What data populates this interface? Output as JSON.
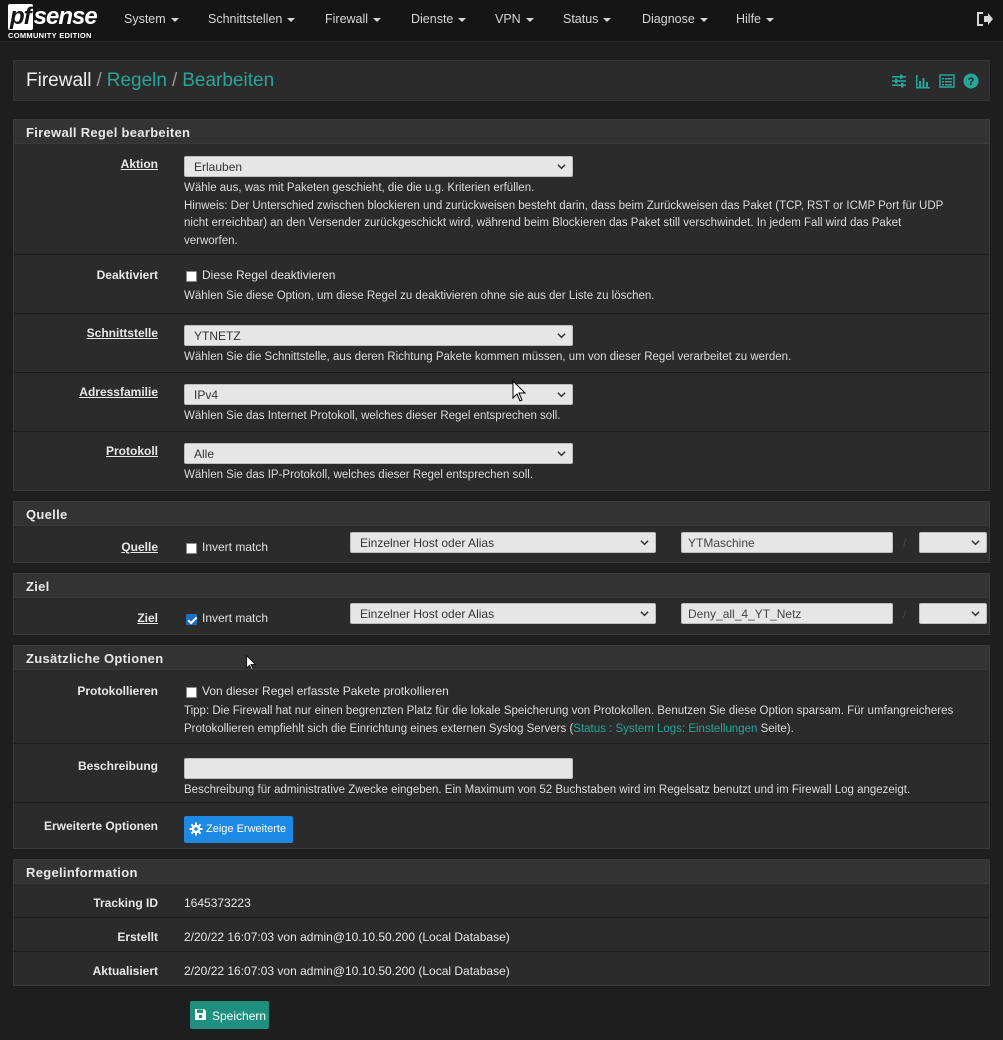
{
  "nav": {
    "logo_main": "sense",
    "logo_pf": "pf",
    "logo_sub": "COMMUNITY EDITION",
    "items": [
      "System",
      "Schnittstellen",
      "Firewall",
      "Dienste",
      "VPN",
      "Status",
      "Diagnose",
      "Hilfe"
    ]
  },
  "breadcrumb": {
    "root": "Firewall",
    "sep1": "/",
    "link1": "Regeln",
    "sep2": "/",
    "link2": "Bearbeiten"
  },
  "icons": {
    "bc": [
      "sliders-icon",
      "bar-chart-icon",
      "list-icon",
      "help-icon"
    ],
    "logout": "logout-icon"
  },
  "edit": {
    "heading": "Firewall Regel bearbeiten",
    "action": {
      "label": "Aktion",
      "value": "Erlauben",
      "help1": "Wähle aus, was mit Paketen geschieht, die die u.g. Kriterien erfüllen.",
      "help2": "Hinweis: Der Unterschied zwischen blockieren und zurückweisen besteht darin, dass beim Zurückweisen das Paket (TCP, RST or ICMP Port für UDP",
      "help3": "nicht erreichbar) an den Versender zurückgeschickt wird, während beim Blockieren das Paket still verschwindet. In jedem Fall wird das Paket",
      "help4": "verworfen."
    },
    "disabled": {
      "label": "Deaktiviert",
      "checkbox": "Diese Regel deaktivieren",
      "checked": false,
      "help": "Wählen Sie diese Option, um diese Regel zu deaktivieren ohne sie aus der Liste zu löschen."
    },
    "interface": {
      "label": "Schnittstelle",
      "value": "YTNETZ",
      "help": "Wählen Sie die Schnittstelle, aus deren Richtung Pakete kommen müssen, um von dieser Regel verarbeitet zu werden."
    },
    "family": {
      "label": "Adressfamilie",
      "value": "IPv4",
      "help": "Wählen Sie das Internet Protokoll, welches dieser Regel entsprechen soll."
    },
    "protocol": {
      "label": "Protokoll",
      "value": "Alle",
      "help": "Wählen Sie das IP-Protokoll, welches dieser Regel entsprechen soll."
    }
  },
  "source": {
    "heading": "Quelle",
    "label": "Quelle",
    "invert": "Invert match",
    "invert_checked": false,
    "type": "Einzelner Host oder Alias",
    "address": "YTMaschine",
    "slash": "/",
    "mask": ""
  },
  "dest": {
    "heading": "Ziel",
    "label": "Ziel",
    "invert": "Invert match",
    "invert_checked": true,
    "type": "Einzelner Host oder Alias",
    "address": "Deny_all_4_YT_Netz",
    "slash": "/",
    "mask": ""
  },
  "extra": {
    "heading": "Zusätzliche Optionen",
    "log": {
      "label": "Protokollieren",
      "checkbox": "Von dieser Regel erfasste Pakete protkollieren",
      "checked": false,
      "help1": "Tipp: Die Firewall hat nur einen begrenzten Platz für die lokale Speicherung von Protokollen. Benutzen Sie diese Option sparsam. Für umfangreicheres",
      "help2_pre": "Protokollieren empfiehlt sich die Einrichtung eines externen Syslog Servers (",
      "help2_link": "Status : System Logs: Einstellungen",
      "help2_post": " Seite)."
    },
    "desc": {
      "label": "Beschreibung",
      "value": "",
      "help": "Beschreibung für administrative Zwecke eingeben. Ein Maximum von 52 Buchstaben wird im Regelsatz benutzt und im Firewall Log angezeigt."
    },
    "advanced": {
      "label": "Erweiterte Optionen",
      "button": "Zeige Erweiterte"
    }
  },
  "info": {
    "heading": "Regelinformation",
    "tracking_label": "Tracking ID",
    "tracking_value": "1645373223",
    "created_label": "Erstellt",
    "created_value": "2/20/22 16:07:03 von admin@10.10.50.200 (Local Database)",
    "updated_label": "Aktualisiert",
    "updated_value": "2/20/22 16:07:03 von admin@10.10.50.200 (Local Database)"
  },
  "save_button": "Speichern",
  "colors": {
    "accent": "#26a69a",
    "primary": "#1e88e5",
    "success": "#1f8f7f",
    "bg": "#1e1e1e",
    "panel": "#2b2b2b"
  }
}
